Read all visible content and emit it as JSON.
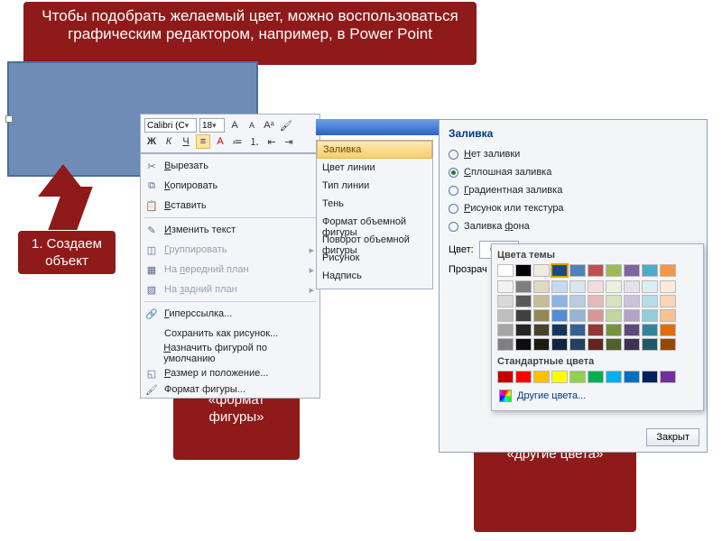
{
  "banner": "Чтобы подобрать желаемый цвет, можно воспользоваться графическим редактором, например, в Power Point",
  "callouts": {
    "c1": "1. Создаем объект",
    "c2": "2. Выбираем «формат фигуры»",
    "c3": "3. Открываем вкладку «другие цвета»"
  },
  "mini_toolbar": {
    "font": "Calibri (С",
    "size": "18",
    "bold": "Ж",
    "italic": "К",
    "underline": "Ч"
  },
  "context_menu": [
    {
      "icon": "✂",
      "label": "Вырезать",
      "u": 0
    },
    {
      "icon": "⧉",
      "label": "Копировать",
      "u": 0
    },
    {
      "icon": "📋",
      "label": "Вставить",
      "u": 0
    },
    {
      "sep": true
    },
    {
      "icon": "✎",
      "label": "Изменить текст",
      "u": 0
    },
    {
      "icon": "◫",
      "label": "Группировать",
      "u": 0,
      "arrow": true,
      "disabled": true
    },
    {
      "icon": "▦",
      "label": "На передний план",
      "u": 3,
      "arrow": true,
      "disabled": true
    },
    {
      "icon": "▧",
      "label": "На задний план",
      "u": 3,
      "arrow": true,
      "disabled": true
    },
    {
      "sep": true
    },
    {
      "icon": "🔗",
      "label": "Гиперссылка...",
      "u": 0
    },
    {
      "icon": "",
      "label": "Сохранить как рисунок...",
      "u": -1
    },
    {
      "icon": "",
      "label": "Назначить фигурой по умолчанию",
      "u": 0
    },
    {
      "icon": "◱",
      "label": "Размер и положение...",
      "u": 0
    },
    {
      "icon": "🖌",
      "label": "Формат фигуры...",
      "u": -1,
      "cut": true
    }
  ],
  "submenu": {
    "title": "Заливка",
    "items": [
      "Цвет линии",
      "Тип линии",
      "Тень",
      "Формат объемной фигуры",
      "Поворот объемной фигуры",
      "Рисунок",
      "Надпись"
    ]
  },
  "dialog": {
    "title": "Заливка",
    "radios": [
      {
        "label": "Нет заливки",
        "sel": false,
        "u": 0
      },
      {
        "label": "Сплошная заливка",
        "sel": true,
        "u": 0
      },
      {
        "label": "Градиентная заливка",
        "sel": false,
        "u": 0
      },
      {
        "label": "Рисунок или текстура",
        "sel": false,
        "u": 0
      },
      {
        "label": "Заливка фона",
        "sel": false,
        "u": 8
      }
    ],
    "color_label": "Цвет:",
    "transparency_label": "Прозрач",
    "close": "Закрыт"
  },
  "color_popup": {
    "theme_title": "Цвета темы",
    "theme_row": [
      "#ffffff",
      "#000000",
      "#eeece1",
      "#1f497d",
      "#4f81bd",
      "#c0504d",
      "#9bbb59",
      "#8064a2",
      "#4bacc6",
      "#f79646"
    ],
    "tints": [
      [
        "#f2f2f2",
        "#7f7f7f",
        "#ddd9c3",
        "#c6d9f0",
        "#dbe5f1",
        "#f2dcdb",
        "#ebf1dd",
        "#e5e0ec",
        "#dbeef3",
        "#fdeada"
      ],
      [
        "#d9d9d9",
        "#595959",
        "#c4bd97",
        "#8db3e2",
        "#b8cce4",
        "#e5b9b7",
        "#d7e3bc",
        "#ccc1d9",
        "#b7dde8",
        "#fbd5b5"
      ],
      [
        "#bfbfbf",
        "#404040",
        "#938953",
        "#548dd4",
        "#95b3d7",
        "#d99694",
        "#c3d69b",
        "#b2a2c7",
        "#92cddc",
        "#fac08f"
      ],
      [
        "#a6a6a6",
        "#262626",
        "#494429",
        "#17365d",
        "#366092",
        "#953734",
        "#76923c",
        "#5f497a",
        "#31859b",
        "#e36c09"
      ],
      [
        "#808080",
        "#0d0d0d",
        "#1d1b10",
        "#0f243e",
        "#244061",
        "#632423",
        "#4f6128",
        "#3f3151",
        "#205867",
        "#974806"
      ]
    ],
    "std_title": "Стандартные цвета",
    "std": [
      "#c00000",
      "#ff0000",
      "#ffc000",
      "#ffff00",
      "#92d050",
      "#00b050",
      "#00b0f0",
      "#0070c0",
      "#002060",
      "#7030a0"
    ],
    "more": "Другие цвета...",
    "selected_index": 3
  }
}
